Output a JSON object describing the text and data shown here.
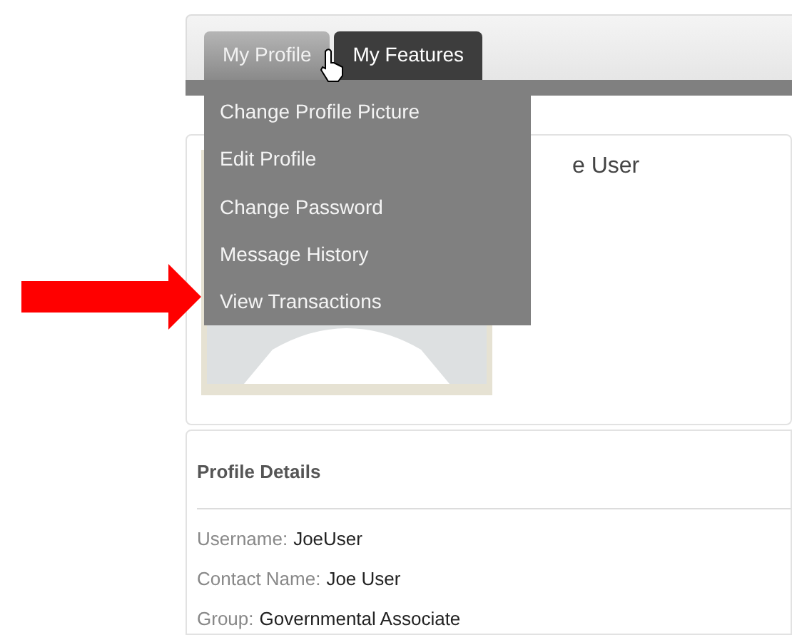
{
  "tabs": [
    {
      "label": "My Profile",
      "selected": true
    },
    {
      "label": "My Features",
      "selected": false
    }
  ],
  "dropdown": {
    "items": [
      "Change Profile Picture",
      "Edit Profile",
      "Change Password",
      "Message History",
      "View Transactions"
    ]
  },
  "profile_card": {
    "name_fragment": "e User"
  },
  "profile_details": {
    "title": "Profile Details",
    "fields": [
      {
        "label": "Username:",
        "value": "JoeUser"
      },
      {
        "label": "Contact Name:",
        "value": "Joe User"
      },
      {
        "label": "Group:",
        "value": "Governmental Associate"
      }
    ]
  }
}
